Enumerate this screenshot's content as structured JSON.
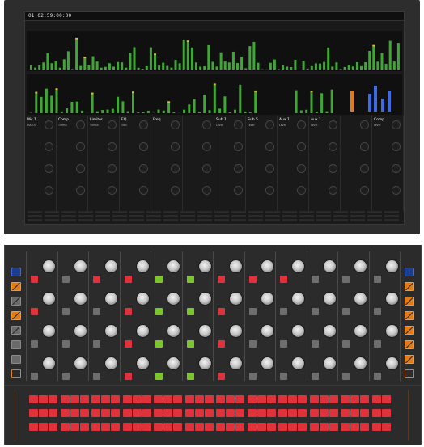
{
  "screen": {
    "timecode": "01:02:59:00:00"
  },
  "colors": {
    "accent_red": "#e0323a",
    "accent_green": "#7bc62d",
    "accent_orange": "#e07b18",
    "accent_blue": "#3f6be0",
    "button_grey": "#6e6e6e"
  },
  "strips": [
    {
      "name": "Mic 1",
      "sub": "DIALOG"
    },
    {
      "name": "Comp",
      "sub": "Thresh"
    },
    {
      "name": "Limiter",
      "sub": "Thresh"
    },
    {
      "name": "EQ",
      "sub": "Gain"
    },
    {
      "name": "Freq",
      "sub": ""
    },
    {
      "name": "",
      "sub": ""
    },
    {
      "name": "Sub 1",
      "sub": "Level"
    },
    {
      "name": "Sub 5",
      "sub": "Level"
    },
    {
      "name": "Aux 1",
      "sub": "Level"
    },
    {
      "name": "Aux 1",
      "sub": "Level"
    },
    {
      "name": "",
      "sub": ""
    },
    {
      "name": "Comp",
      "sub": "Level"
    }
  ],
  "hardware": {
    "channels": 12,
    "knob_rows": 4,
    "button_rows": 4,
    "pad_columns_per_channel": 3,
    "pad_rows": 3,
    "left_side_buttons": [
      "blue",
      "orange-slash",
      "grey-slash",
      "orange-slash",
      "grey-slash",
      "grey",
      "grey",
      "orange-outline"
    ],
    "right_side_buttons": [
      "blue",
      "orange-slash",
      "orange-slash",
      "orange-slash",
      "orange-slash",
      "orange-slash",
      "orange-slash",
      "orange-outline"
    ],
    "buttons": [
      [
        "red",
        "grey",
        "red",
        "red",
        "green",
        "green",
        "red",
        "red",
        "red",
        "grey",
        "grey",
        "grey"
      ],
      [
        "red",
        "grey",
        "grey",
        "red",
        "green",
        "green",
        "red",
        "grey",
        "grey",
        "grey",
        "grey",
        "grey"
      ],
      [
        "grey",
        "grey",
        "grey",
        "red",
        "green",
        "green",
        "red",
        "grey",
        "grey",
        "grey",
        "grey",
        "grey"
      ],
      [
        "grey",
        "grey",
        "grey",
        "red",
        "green",
        "green",
        "red",
        "grey",
        "grey",
        "grey",
        "grey",
        "grey"
      ]
    ]
  }
}
